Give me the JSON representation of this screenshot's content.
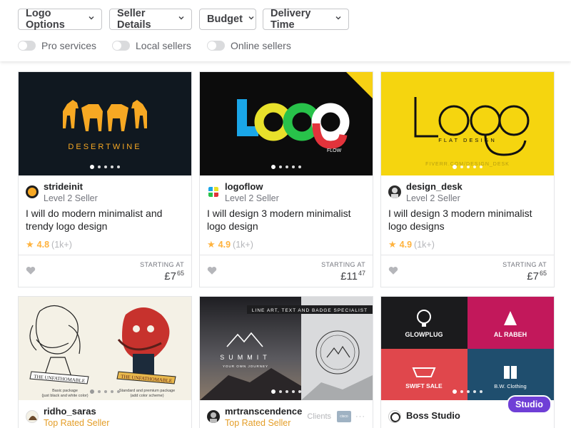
{
  "filters": {
    "dropdowns": [
      "Logo Options",
      "Seller Details",
      "Budget",
      "Delivery Time"
    ],
    "toggles": [
      "Pro services",
      "Local sellers",
      "Online sellers"
    ]
  },
  "cards": [
    {
      "seller": "strideinit",
      "level": "Level 2 Seller",
      "title": "I will do modern minimalist and trendy logo design",
      "score": "4.8",
      "count": "(1k+)",
      "starting": "STARTING AT",
      "price_main": "£7",
      "price_cents": "65",
      "thumb_text": "DESERTWINE"
    },
    {
      "seller": "logoflow",
      "level": "Level 2 Seller",
      "title": "I will design 3 modern minimalist logo design",
      "score": "4.9",
      "count": "(1k+)",
      "starting": "STARTING AT",
      "price_main": "£11",
      "price_cents": "47",
      "thumb_text": "FLOW"
    },
    {
      "seller": "design_desk",
      "level": "Level 2 Seller",
      "title": "I will design 3 modern minimalist logo designs",
      "score": "4.9",
      "count": "(1k+)",
      "starting": "STARTING AT",
      "price_main": "£7",
      "price_cents": "65",
      "thumb_text": "FLAT DESIGN",
      "thumb_sub": "FIVERR.COM/DESIGN_DESK"
    },
    {
      "seller": "ridho_saras",
      "level": "Top Rated Seller",
      "thumb_text": "THE UNFATHOMABLE",
      "thumb_left_caption": "Basic package\n(just black and white color)",
      "thumb_right_caption": "Standard and premium package\n(add color scheme)"
    },
    {
      "seller": "mrtranscendence",
      "level": "Top Rated Seller",
      "clients_label": "Clients",
      "thumb_text": "LINE ART, TEXT AND BADGE SPECIALIST",
      "thumb_summit": "SUMMIT",
      "thumb_journey": "YOUR OWN JOURNEY"
    },
    {
      "seller": "Boss Studio",
      "badge": "Studio",
      "thumb_tiles": [
        "GLOWPLUG",
        "AL RABEH",
        "SWIFT SALE",
        "B.W. Clothing"
      ]
    }
  ]
}
